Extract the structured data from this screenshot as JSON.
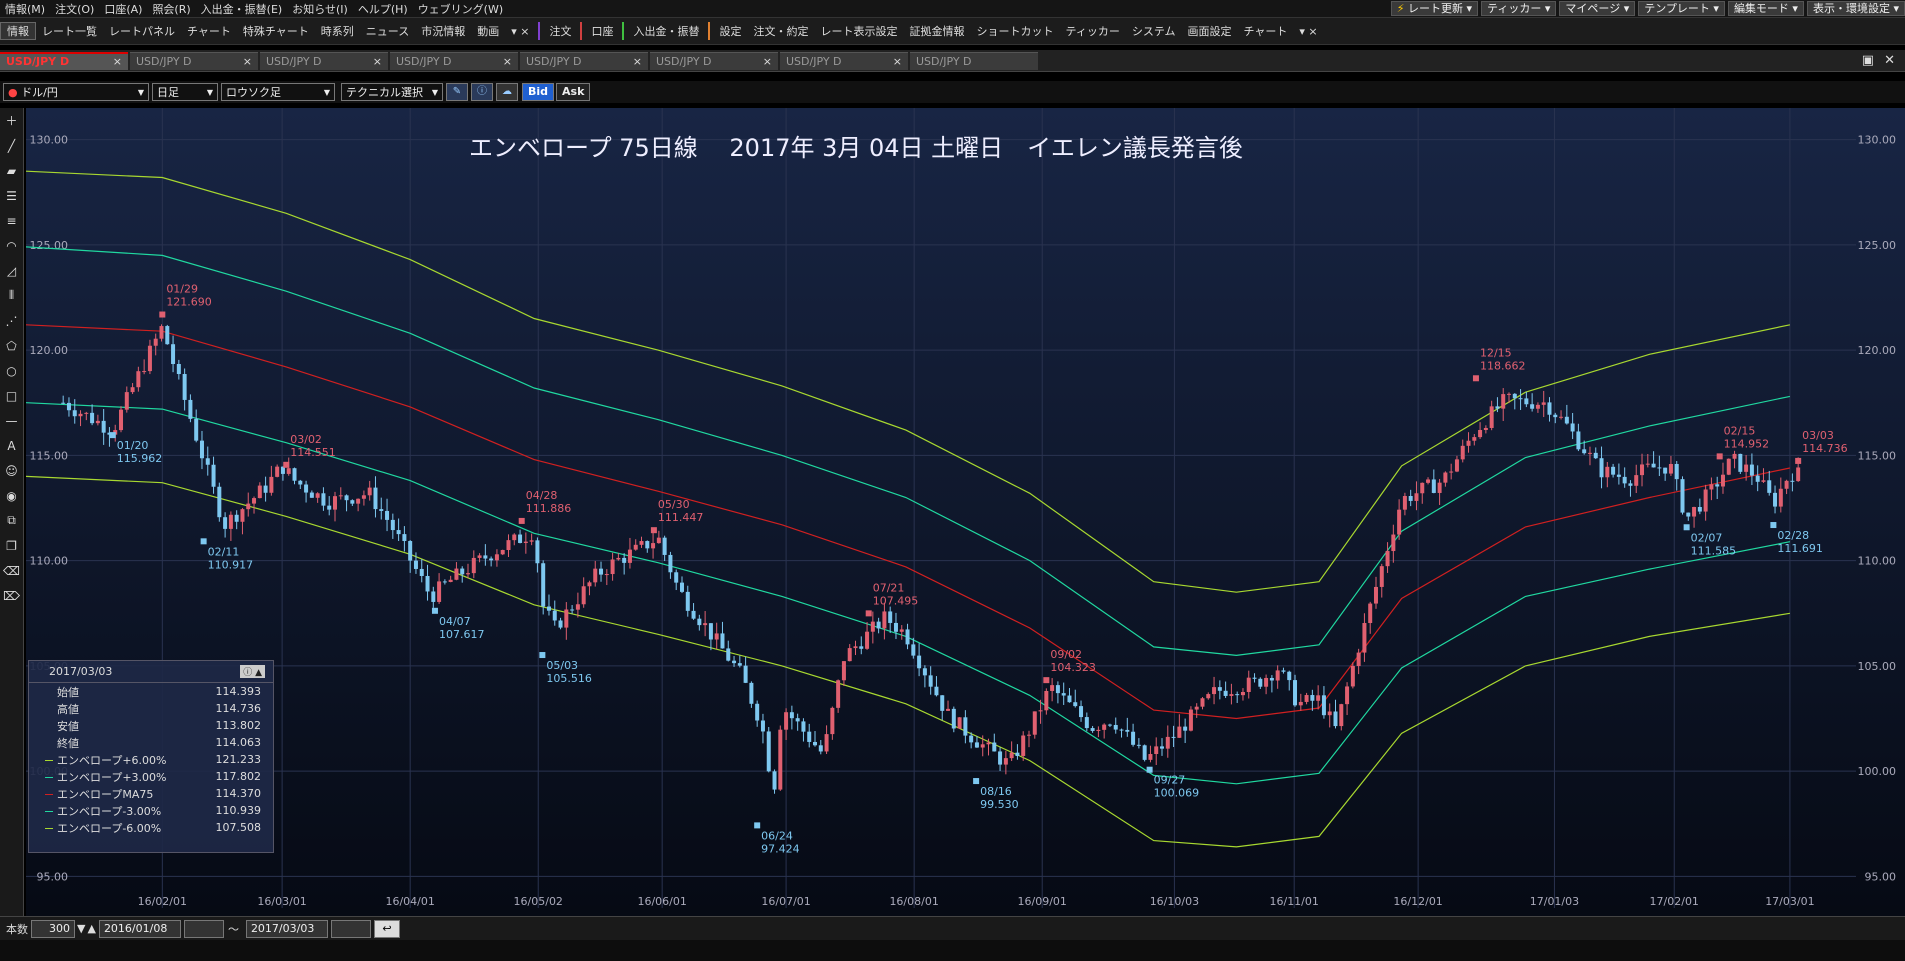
{
  "menu": {
    "items": [
      "情報(M)",
      "注文(O)",
      "口座(A)",
      "照会(R)",
      "入出金・振替(E)",
      "お知らせ(I)",
      "ヘルプ(H)",
      "ウェブリング(W)"
    ],
    "right_buttons": [
      "レート更新",
      "ティッカー",
      "マイページ",
      "テンプレート",
      "編集モード",
      "表示・環境設定"
    ]
  },
  "toolbar": {
    "info": "情報",
    "items": [
      "レート一覧",
      "レートパネル",
      "チャート",
      "特殊チャート",
      "時系列",
      "ニュース",
      "市況情報",
      "動画"
    ],
    "order": "注文",
    "account": "口座",
    "deposit": "入出金・振替",
    "settings": "設定",
    "items2": [
      "注文・約定",
      "レート表示設定",
      "証拠金情報",
      "ショートカット",
      "ティッカー",
      "システム",
      "画面設定",
      "チャート"
    ]
  },
  "tabs": [
    {
      "label": "USD/JPY D",
      "active": true
    },
    {
      "label": "USD/JPY D"
    },
    {
      "label": "USD/JPY D"
    },
    {
      "label": "USD/JPY D"
    },
    {
      "label": "USD/JPY D"
    },
    {
      "label": "USD/JPY D"
    },
    {
      "label": "USD/JPY D"
    },
    {
      "label": "USD/JPY D"
    }
  ],
  "controls": {
    "pair": "ドル/円",
    "period": "日足",
    "chart_type": "ロウソク足",
    "technical": "テクニカル選択",
    "bid": "Bid",
    "ask": "Ask"
  },
  "bottom": {
    "count_label": "本数",
    "count": "300",
    "start": "2016/01/08",
    "tilde": "～",
    "end": "2017/03/03"
  },
  "colors": {
    "background": "#0b1020",
    "up": "#e06070",
    "down": "#7ec8f0",
    "env6": "#a8d830",
    "env3": "#20d8a0",
    "ma": "#d02020",
    "grid": "#2a3350"
  },
  "panel": {
    "date": "2017/03/03",
    "rows": [
      {
        "label": "始値",
        "value": "114.393"
      },
      {
        "label": "高値",
        "value": "114.736"
      },
      {
        "label": "安値",
        "value": "113.802"
      },
      {
        "label": "終値",
        "value": "114.063"
      },
      {
        "label": "エンベロープ+6.00%",
        "value": "121.233",
        "color": "#a8d830"
      },
      {
        "label": "エンベロープ+3.00%",
        "value": "117.802",
        "color": "#20d8a0"
      },
      {
        "label": "エンベロープMA75",
        "value": "114.370",
        "color": "#d02020"
      },
      {
        "label": "エンベロープ-3.00%",
        "value": "110.939",
        "color": "#20d8a0"
      },
      {
        "label": "エンベロープ-6.00%",
        "value": "107.508",
        "color": "#a8d830"
      }
    ]
  },
  "chart_data": {
    "type": "line",
    "title": "エンベロープ 75日線　 2017年 3月 04日 土曜日　イエレン議長発言後",
    "ylim": [
      93.5,
      131.5
    ],
    "yticks": [
      95,
      100,
      105,
      110,
      115,
      120,
      125,
      130
    ],
    "ytick_labels": [
      "95.00",
      "100.00",
      "105.00",
      "110.00",
      "115.00",
      "120.00",
      "125.00",
      "130.00"
    ],
    "xlim": [
      -33,
      410
    ],
    "xticks": [
      {
        "label": "16/02/01",
        "d": 0
      },
      {
        "label": "16/03/01",
        "d": 29
      },
      {
        "label": "16/04/01",
        "d": 60
      },
      {
        "label": "16/05/02",
        "d": 91
      },
      {
        "label": "16/06/01",
        "d": 121
      },
      {
        "label": "16/07/01",
        "d": 151
      },
      {
        "label": "16/08/01",
        "d": 182
      },
      {
        "label": "16/09/01",
        "d": 213
      },
      {
        "label": "16/10/03",
        "d": 245
      },
      {
        "label": "16/11/01",
        "d": 274
      },
      {
        "label": "16/12/01",
        "d": 304
      },
      {
        "label": "17/01/03",
        "d": 337
      },
      {
        "label": "17/02/01",
        "d": 366
      },
      {
        "label": "17/03/01",
        "d": 394
      }
    ],
    "price_line": {
      "x": [
        -24,
        -12,
        -6,
        0,
        4,
        10,
        15,
        25,
        29,
        32,
        40,
        50,
        55,
        65,
        70,
        80,
        90,
        92,
        95,
        105,
        110,
        115,
        120,
        125,
        140,
        145,
        148,
        150,
        160,
        165,
        175,
        180,
        190,
        195,
        200,
        205,
        210,
        215,
        225,
        230,
        238,
        245,
        255,
        265,
        270,
        275,
        280,
        284,
        290,
        300,
        310,
        318,
        325,
        335,
        340,
        348,
        355,
        360,
        365,
        369,
        375,
        380,
        386,
        390,
        394,
        396
      ],
      "y": [
        117.5,
        116.2,
        118.7,
        121.1,
        118.5,
        114.8,
        111.7,
        113.5,
        114.5,
        113.8,
        112.8,
        113.2,
        111.8,
        108.3,
        109.1,
        110.4,
        111.4,
        107.9,
        106.8,
        109.3,
        110.0,
        110.5,
        111.1,
        108.6,
        104.6,
        102.3,
        99.0,
        103.1,
        100.8,
        105.4,
        107.3,
        106.5,
        102.7,
        101.8,
        101.0,
        100.3,
        102.0,
        104.0,
        102.1,
        102.5,
        100.5,
        101.7,
        103.8,
        104.2,
        104.9,
        103.2,
        103.4,
        102.0,
        106.2,
        112.9,
        113.8,
        116.2,
        117.6,
        117.5,
        116.4,
        114.3,
        113.9,
        114.4,
        114.5,
        112.0,
        113.3,
        114.8,
        114.0,
        112.7,
        114.2,
        114.1
      ]
    },
    "series": [
      {
        "name": "エンベロープ+6.00%",
        "color": "#a8d830",
        "x": [
          -33,
          0,
          30,
          60,
          90,
          120,
          150,
          180,
          210,
          240,
          260,
          280,
          300,
          330,
          360,
          394
        ],
        "y": [
          128.5,
          128.2,
          126.5,
          124.3,
          121.5,
          120.0,
          118.3,
          116.2,
          113.2,
          109.0,
          108.5,
          109.0,
          114.5,
          118.0,
          119.8,
          121.2
        ]
      },
      {
        "name": "エンベロープ+3.00%",
        "color": "#20d8a0",
        "x": [
          -33,
          0,
          30,
          60,
          90,
          120,
          150,
          180,
          210,
          240,
          260,
          280,
          300,
          330,
          360,
          394
        ],
        "y": [
          124.9,
          124.5,
          122.8,
          120.8,
          118.2,
          116.7,
          115.0,
          113.0,
          110.0,
          105.9,
          105.5,
          106.0,
          111.4,
          114.9,
          116.4,
          117.8
        ]
      },
      {
        "name": "エンベロープMA75",
        "color": "#d02020",
        "x": [
          -33,
          0,
          30,
          60,
          90,
          120,
          150,
          180,
          210,
          240,
          260,
          280,
          300,
          330,
          360,
          394
        ],
        "y": [
          121.2,
          120.9,
          119.2,
          117.3,
          114.8,
          113.3,
          111.7,
          109.7,
          106.8,
          102.9,
          102.5,
          103.0,
          108.2,
          111.6,
          113.0,
          114.4
        ]
      },
      {
        "name": "エンベロープ-3.00%",
        "color": "#20d8a0",
        "x": [
          -33,
          0,
          30,
          60,
          90,
          120,
          150,
          180,
          210,
          240,
          260,
          280,
          300,
          330,
          360,
          394
        ],
        "y": [
          117.5,
          117.2,
          115.6,
          113.8,
          111.3,
          109.9,
          108.3,
          106.4,
          103.6,
          99.8,
          99.4,
          99.9,
          104.9,
          108.3,
          109.6,
          110.9
        ]
      },
      {
        "name": "エンベロープ-6.00%",
        "color": "#a8d830",
        "x": [
          -33,
          0,
          30,
          60,
          90,
          120,
          150,
          180,
          210,
          240,
          260,
          280,
          300,
          330,
          360,
          394
        ],
        "y": [
          114.0,
          113.7,
          112.1,
          110.3,
          107.9,
          106.5,
          105.0,
          103.2,
          100.5,
          96.7,
          96.4,
          96.9,
          101.8,
          105.0,
          106.4,
          107.5
        ]
      }
    ],
    "annotations": [
      {
        "date": "01/29",
        "value": "121.690",
        "d": 0,
        "y": 121.69,
        "kind": "high"
      },
      {
        "date": "01/20",
        "value": "115.962",
        "d": -12,
        "y": 115.962,
        "kind": "low"
      },
      {
        "date": "02/11",
        "value": "110.917",
        "d": 10,
        "y": 110.917,
        "kind": "low"
      },
      {
        "date": "03/02",
        "value": "114.551",
        "d": 30,
        "y": 114.551,
        "kind": "high"
      },
      {
        "date": "04/07",
        "value": "107.617",
        "d": 66,
        "y": 107.617,
        "kind": "low"
      },
      {
        "date": "04/28",
        "value": "111.886",
        "d": 87,
        "y": 111.886,
        "kind": "high"
      },
      {
        "date": "05/03",
        "value": "105.516",
        "d": 92,
        "y": 105.516,
        "kind": "low"
      },
      {
        "date": "05/30",
        "value": "111.447",
        "d": 119,
        "y": 111.447,
        "kind": "high"
      },
      {
        "date": "06/24",
        "value": "97.424",
        "d": 144,
        "y": 97.424,
        "kind": "low"
      },
      {
        "date": "07/21",
        "value": "107.495",
        "d": 171,
        "y": 107.495,
        "kind": "high"
      },
      {
        "date": "08/16",
        "value": "99.530",
        "d": 197,
        "y": 99.53,
        "kind": "low"
      },
      {
        "date": "09/02",
        "value": "104.323",
        "d": 214,
        "y": 104.323,
        "kind": "high"
      },
      {
        "date": "09/27",
        "value": "100.069",
        "d": 239,
        "y": 100.069,
        "kind": "low"
      },
      {
        "date": "12/15",
        "value": "118.662",
        "d": 318,
        "y": 118.662,
        "kind": "high"
      },
      {
        "date": "02/07",
        "value": "111.585",
        "d": 369,
        "y": 111.585,
        "kind": "low"
      },
      {
        "date": "02/15",
        "value": "114.952",
        "d": 377,
        "y": 114.952,
        "kind": "high"
      },
      {
        "date": "02/28",
        "value": "111.691",
        "d": 390,
        "y": 111.691,
        "kind": "low"
      },
      {
        "date": "03/03",
        "value": "114.736",
        "d": 396,
        "y": 114.736,
        "kind": "high"
      }
    ]
  }
}
